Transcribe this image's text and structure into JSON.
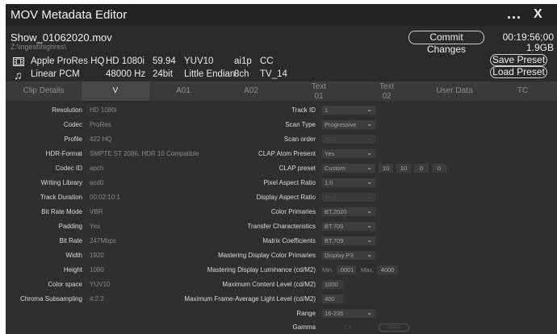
{
  "window": {
    "title": "MOV Metadata Editor",
    "more_label": "...",
    "close_label": "X"
  },
  "file": {
    "name": "Show_01062020.mov",
    "path": "Z:\\ingest\\highres\\",
    "timecode": "00:19:56;00",
    "size": "1.9GB",
    "commit_label": "Commit Changes",
    "save_preset_label": "Save Preset",
    "load_preset_label": "Load Preset"
  },
  "video_summary": {
    "codec": "Apple ProRes HQ",
    "resolution": "HD 1080i",
    "fps": "59.94",
    "color": "YUV10",
    "field": "ai1p",
    "cc": "CC",
    "icon": "film-icon"
  },
  "audio_summary": {
    "codec": "Linear PCM",
    "rate": "48000 Hz",
    "bits": "24bit",
    "endian": "Little Endian",
    "channels": "8ch",
    "tv": "TV_14",
    "icon": "music-note-icon"
  },
  "tabs": [
    {
      "label": "Clip Details"
    },
    {
      "label": "V"
    },
    {
      "label": "A01"
    },
    {
      "label": "A02"
    },
    {
      "line1": "Text",
      "line2": "01"
    },
    {
      "line1": "Text",
      "line2": "02"
    },
    {
      "label": "User Data"
    },
    {
      "label": "TC"
    }
  ],
  "left_fields": [
    {
      "label": "Resolution",
      "value": "HD 1080i"
    },
    {
      "label": "Codec",
      "value": "ProRes"
    },
    {
      "label": "Profile",
      "value": "422 HQ"
    },
    {
      "label": "HDR-Format",
      "value": "SMPTE ST 2086, HDR 10 Compatible"
    },
    {
      "label": "Codec ID",
      "value": "apch"
    },
    {
      "label": "Writing Library",
      "value": "acd0"
    },
    {
      "label": "Track Duration",
      "value": "00:02:10:1"
    },
    {
      "label": "Bit Rate Mode",
      "value": "VBR"
    },
    {
      "label": "Padding",
      "value": "Yes"
    },
    {
      "label": "Bit Rate",
      "value": "247Mbps"
    },
    {
      "label": "Width",
      "value": "1920"
    },
    {
      "label": "Height",
      "value": "1080"
    },
    {
      "label": "Color space",
      "value": "YUV10"
    },
    {
      "label": "Chroma Subsampling",
      "value": "4:2:2"
    }
  ],
  "right_fields": {
    "track_id": {
      "label": "Track ID",
      "value": "1"
    },
    "scan_type": {
      "label": "Scan Type",
      "value": "Progressive"
    },
    "scan_order": {
      "label": "Scan order",
      "value": "ADJ"
    },
    "clap_atom": {
      "label": "CLAP Atom Present",
      "value": "Yes"
    },
    "clap_preset": {
      "label": "CLAP preset",
      "value": "Custom",
      "n1": "10",
      "n2": "10",
      "n3": "0",
      "n4": "0"
    },
    "pixel_aspect": {
      "label": "Pixel Aspect Ratio",
      "value": "1.0"
    },
    "display_aspect": {
      "label": "Display Aspect Ratio",
      "value": "16:9"
    },
    "color_primaries": {
      "label": "Color Primaries",
      "value": "BT.2020"
    },
    "transfer": {
      "label": "Transfer Characteristics",
      "value": "BT.709"
    },
    "matrix": {
      "label": "Matrix Coefficients",
      "value": "BT.709"
    },
    "mastering_primaries": {
      "label": "Mastering Display Color Primaries",
      "value": "Display P3"
    },
    "mastering_luminance": {
      "label": "Mastering Display Luminance (cd/M2)",
      "min_label": "Min.",
      "min_value": ".0001",
      "max_label": "Max.",
      "max_value": "4000"
    },
    "max_content": {
      "label": "Maximum Content Level (cd/M2)",
      "value": "1000"
    },
    "max_frame_avg": {
      "label": "Maximum Frame-Average Light Level (cd/M2)",
      "value": "400"
    },
    "range": {
      "label": "Range",
      "value": "16-235"
    },
    "gamma": {
      "label": "Gamma",
      "value": "2.4",
      "apply_label": "apply"
    }
  }
}
